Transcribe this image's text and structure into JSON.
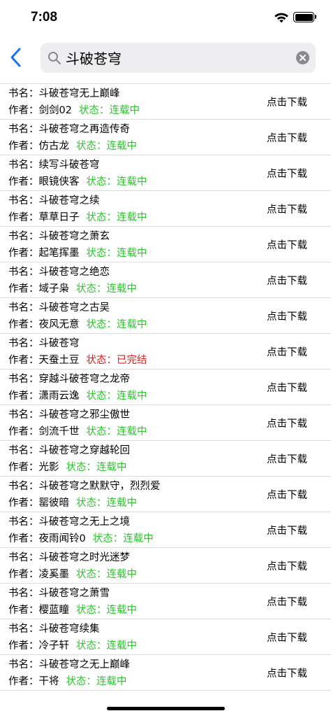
{
  "status_bar": {
    "time": "7:08"
  },
  "search": {
    "query": "斗破苍穹"
  },
  "labels": {
    "title_prefix": "书名：",
    "author_prefix": "作者：",
    "status_prefix": "状态："
  },
  "books": [
    {
      "title": "斗破苍穹无上巅峰",
      "author": "剑剑02",
      "status": "连载中",
      "action": "点击下载"
    },
    {
      "title": "斗破苍穹之再造传奇",
      "author": "仿古龙",
      "status": "连载中",
      "action": "点击下载"
    },
    {
      "title": "续写斗破苍穹",
      "author": "眼镜侠客",
      "status": "连载中",
      "action": "点击下载"
    },
    {
      "title": "斗破苍穹之续",
      "author": "草草日子",
      "status": "连载中",
      "action": "点击下载"
    },
    {
      "title": "斗破苍穹之萧玄",
      "author": "起笔挥墨",
      "status": "连载中",
      "action": "点击下载"
    },
    {
      "title": "斗破苍穹之绝恋",
      "author": "域子枭",
      "status": "连载中",
      "action": "点击下载"
    },
    {
      "title": "斗破苍穹之古吴",
      "author": "夜风无意",
      "status": "连载中",
      "action": "点击下载"
    },
    {
      "title": "斗破苍穹",
      "author": "天蚕土豆",
      "status": "已完结",
      "action": "点击下载"
    },
    {
      "title": "穿越斗破苍穹之龙帝",
      "author": "潇雨云逸",
      "status": "连载中",
      "action": "点击下载"
    },
    {
      "title": "斗破苍穹之邪尘傲世",
      "author": "剑流千世",
      "status": "连载中",
      "action": "点击下载"
    },
    {
      "title": "斗破苍穹之穿越轮回",
      "author": "光影",
      "status": "连载中",
      "action": "点击下载"
    },
    {
      "title": "斗破苍穹之默默守，烈烈爱",
      "author": "罂彼暗",
      "status": "连载中",
      "action": "点击下载"
    },
    {
      "title": "斗破苍穹之无上之境",
      "author": "夜雨闻铃0",
      "status": "连载中",
      "action": "点击下载"
    },
    {
      "title": "斗破苍穹之时光迷梦",
      "author": "凌奚墨",
      "status": "连载中",
      "action": "点击下载"
    },
    {
      "title": "斗破苍穹之萧雪",
      "author": "樱蓝瞳",
      "status": "连载中",
      "action": "点击下载"
    },
    {
      "title": "斗破苍穹续集",
      "author": "冷子轩",
      "status": "连载中",
      "action": "点击下载"
    },
    {
      "title": "斗破苍穹之无上巅峰",
      "author": "干将",
      "status": "连载中",
      "action": "点击下载"
    }
  ],
  "colors": {
    "ongoing": "#2ec42e",
    "finished": "#e02020",
    "accent": "#1a73e8"
  }
}
